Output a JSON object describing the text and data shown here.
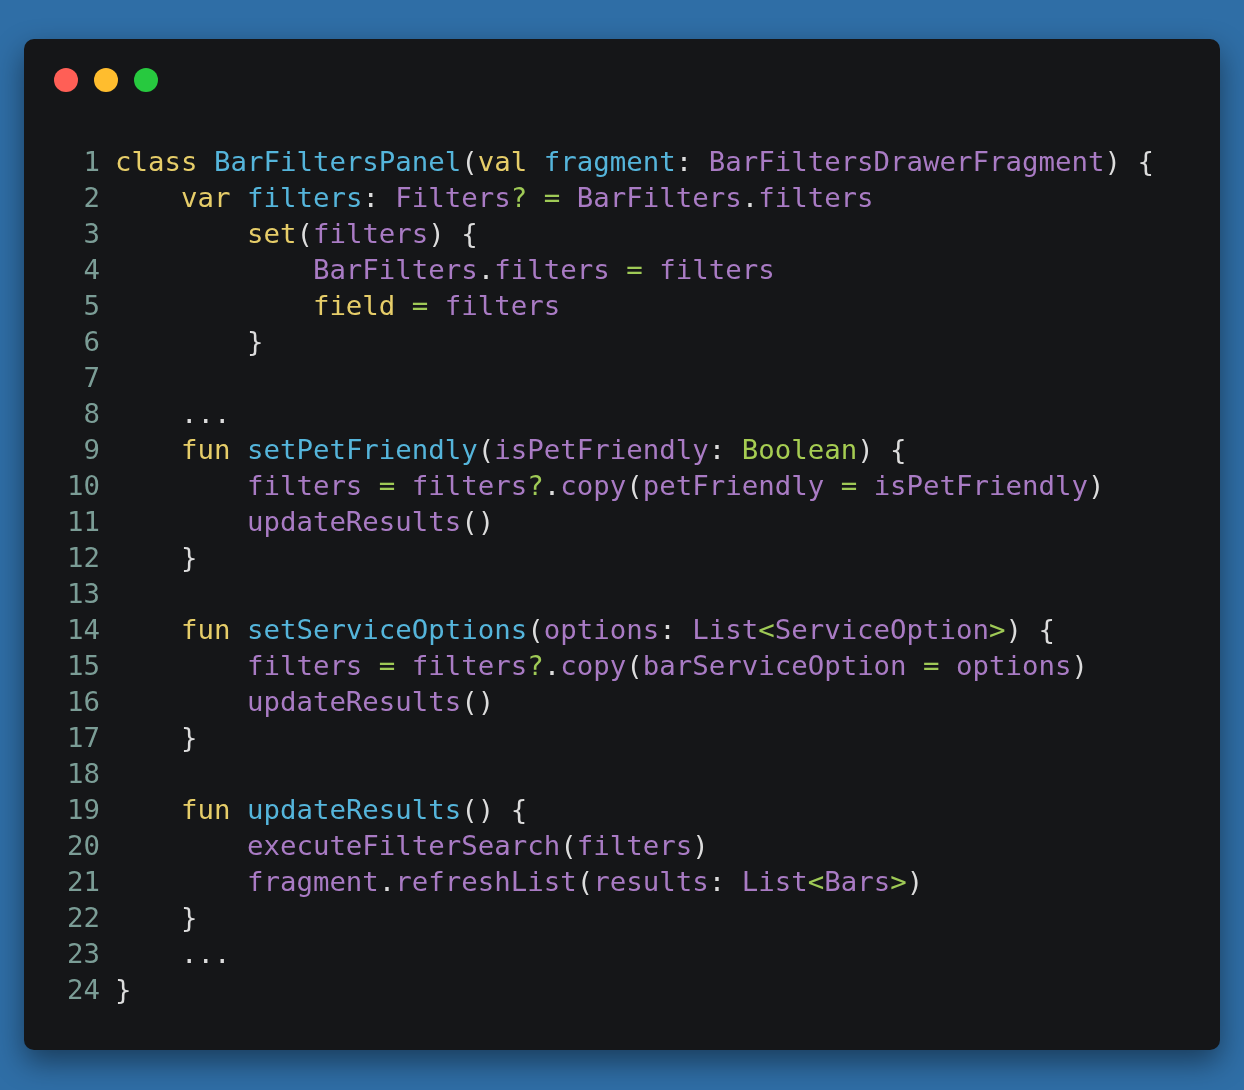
{
  "window": {
    "controls": [
      {
        "color": "#ff5f56"
      },
      {
        "color": "#ffbd2e"
      },
      {
        "color": "#27c93f"
      }
    ]
  },
  "code": {
    "lines": [
      {
        "number": "1",
        "tokens": [
          {
            "t": "class ",
            "kind": "kw"
          },
          {
            "t": "BarFiltersPanel",
            "kind": "fn"
          },
          {
            "t": "(",
            "kind": "p"
          },
          {
            "t": "val ",
            "kind": "kw"
          },
          {
            "t": "fragment",
            "kind": "fn"
          },
          {
            "t": ": ",
            "kind": "p"
          },
          {
            "t": "BarFiltersDrawerFragment",
            "kind": "id"
          },
          {
            "t": ") {",
            "kind": "p"
          }
        ]
      },
      {
        "number": "2",
        "tokens": [
          {
            "t": "    var ",
            "kind": "kw"
          },
          {
            "t": "filters",
            "kind": "fn"
          },
          {
            "t": ": ",
            "kind": "p"
          },
          {
            "t": "Filters",
            "kind": "id"
          },
          {
            "t": "? = ",
            "kind": "op"
          },
          {
            "t": "BarFilters",
            "kind": "id"
          },
          {
            "t": ".",
            "kind": "p"
          },
          {
            "t": "filters",
            "kind": "id"
          }
        ]
      },
      {
        "number": "3",
        "tokens": [
          {
            "t": "        set",
            "kind": "kw"
          },
          {
            "t": "(",
            "kind": "p"
          },
          {
            "t": "filters",
            "kind": "id"
          },
          {
            "t": ") {",
            "kind": "p"
          }
        ]
      },
      {
        "number": "4",
        "tokens": [
          {
            "t": "            BarFilters",
            "kind": "id"
          },
          {
            "t": ".",
            "kind": "p"
          },
          {
            "t": "filters ",
            "kind": "id"
          },
          {
            "t": "= ",
            "kind": "op"
          },
          {
            "t": "filters",
            "kind": "id"
          }
        ]
      },
      {
        "number": "5",
        "tokens": [
          {
            "t": "            field ",
            "kind": "kw"
          },
          {
            "t": "= ",
            "kind": "op"
          },
          {
            "t": "filters",
            "kind": "id"
          }
        ]
      },
      {
        "number": "6",
        "tokens": [
          {
            "t": "        }",
            "kind": "p"
          }
        ]
      },
      {
        "number": "7"
      },
      {
        "number": "8",
        "tokens": [
          {
            "t": "    ...",
            "kind": "p"
          }
        ]
      },
      {
        "number": "9",
        "tokens": [
          {
            "t": "    fun ",
            "kind": "kw"
          },
          {
            "t": "setPetFriendly",
            "kind": "fn"
          },
          {
            "t": "(",
            "kind": "p"
          },
          {
            "t": "isPetFriendly",
            "kind": "id"
          },
          {
            "t": ": ",
            "kind": "p"
          },
          {
            "t": "Boolean",
            "kind": "type"
          },
          {
            "t": ") {",
            "kind": "p"
          }
        ]
      },
      {
        "number": "10",
        "tokens": [
          {
            "t": "        filters ",
            "kind": "id"
          },
          {
            "t": "= ",
            "kind": "op"
          },
          {
            "t": "filters",
            "kind": "id"
          },
          {
            "t": "?",
            "kind": "op"
          },
          {
            "t": ".",
            "kind": "p"
          },
          {
            "t": "copy",
            "kind": "id"
          },
          {
            "t": "(",
            "kind": "p"
          },
          {
            "t": "petFriendly ",
            "kind": "id"
          },
          {
            "t": "= ",
            "kind": "op"
          },
          {
            "t": "isPetFriendly",
            "kind": "id"
          },
          {
            "t": ")",
            "kind": "p"
          }
        ]
      },
      {
        "number": "11",
        "tokens": [
          {
            "t": "        updateResults",
            "kind": "id"
          },
          {
            "t": "()",
            "kind": "p"
          }
        ]
      },
      {
        "number": "12",
        "tokens": [
          {
            "t": "    }",
            "kind": "p"
          }
        ]
      },
      {
        "number": "13"
      },
      {
        "number": "14",
        "tokens": [
          {
            "t": "    fun ",
            "kind": "kw"
          },
          {
            "t": "setServiceOptions",
            "kind": "fn"
          },
          {
            "t": "(",
            "kind": "p"
          },
          {
            "t": "options",
            "kind": "id"
          },
          {
            "t": ": ",
            "kind": "p"
          },
          {
            "t": "List",
            "kind": "id"
          },
          {
            "t": "<",
            "kind": "op"
          },
          {
            "t": "ServiceOption",
            "kind": "id"
          },
          {
            "t": ">",
            "kind": "op"
          },
          {
            "t": ") {",
            "kind": "p"
          }
        ]
      },
      {
        "number": "15",
        "tokens": [
          {
            "t": "        filters ",
            "kind": "id"
          },
          {
            "t": "= ",
            "kind": "op"
          },
          {
            "t": "filters",
            "kind": "id"
          },
          {
            "t": "?",
            "kind": "op"
          },
          {
            "t": ".",
            "kind": "p"
          },
          {
            "t": "copy",
            "kind": "id"
          },
          {
            "t": "(",
            "kind": "p"
          },
          {
            "t": "barServiceOption ",
            "kind": "id"
          },
          {
            "t": "= ",
            "kind": "op"
          },
          {
            "t": "options",
            "kind": "id"
          },
          {
            "t": ")",
            "kind": "p"
          }
        ]
      },
      {
        "number": "16",
        "tokens": [
          {
            "t": "        updateResults",
            "kind": "id"
          },
          {
            "t": "()",
            "kind": "p"
          }
        ]
      },
      {
        "number": "17",
        "tokens": [
          {
            "t": "    }",
            "kind": "p"
          }
        ]
      },
      {
        "number": "18"
      },
      {
        "number": "19",
        "tokens": [
          {
            "t": "    fun ",
            "kind": "kw"
          },
          {
            "t": "updateResults",
            "kind": "fn"
          },
          {
            "t": "() {",
            "kind": "p"
          }
        ]
      },
      {
        "number": "20",
        "tokens": [
          {
            "t": "        executeFilterSearch",
            "kind": "id"
          },
          {
            "t": "(",
            "kind": "p"
          },
          {
            "t": "filters",
            "kind": "id"
          },
          {
            "t": ")",
            "kind": "p"
          }
        ]
      },
      {
        "number": "21",
        "tokens": [
          {
            "t": "        fragment",
            "kind": "id"
          },
          {
            "t": ".",
            "kind": "p"
          },
          {
            "t": "refreshList",
            "kind": "id"
          },
          {
            "t": "(",
            "kind": "p"
          },
          {
            "t": "results",
            "kind": "id"
          },
          {
            "t": ": ",
            "kind": "p"
          },
          {
            "t": "List",
            "kind": "id"
          },
          {
            "t": "<",
            "kind": "op"
          },
          {
            "t": "Bars",
            "kind": "id"
          },
          {
            "t": ">",
            "kind": "op"
          },
          {
            "t": ")",
            "kind": "p"
          }
        ]
      },
      {
        "number": "22",
        "tokens": [
          {
            "t": "    }",
            "kind": "p"
          }
        ]
      },
      {
        "number": "23",
        "tokens": [
          {
            "t": "    ...",
            "kind": "p"
          }
        ]
      },
      {
        "number": "24",
        "tokens": [
          {
            "t": "}",
            "kind": "p"
          }
        ]
      }
    ]
  }
}
